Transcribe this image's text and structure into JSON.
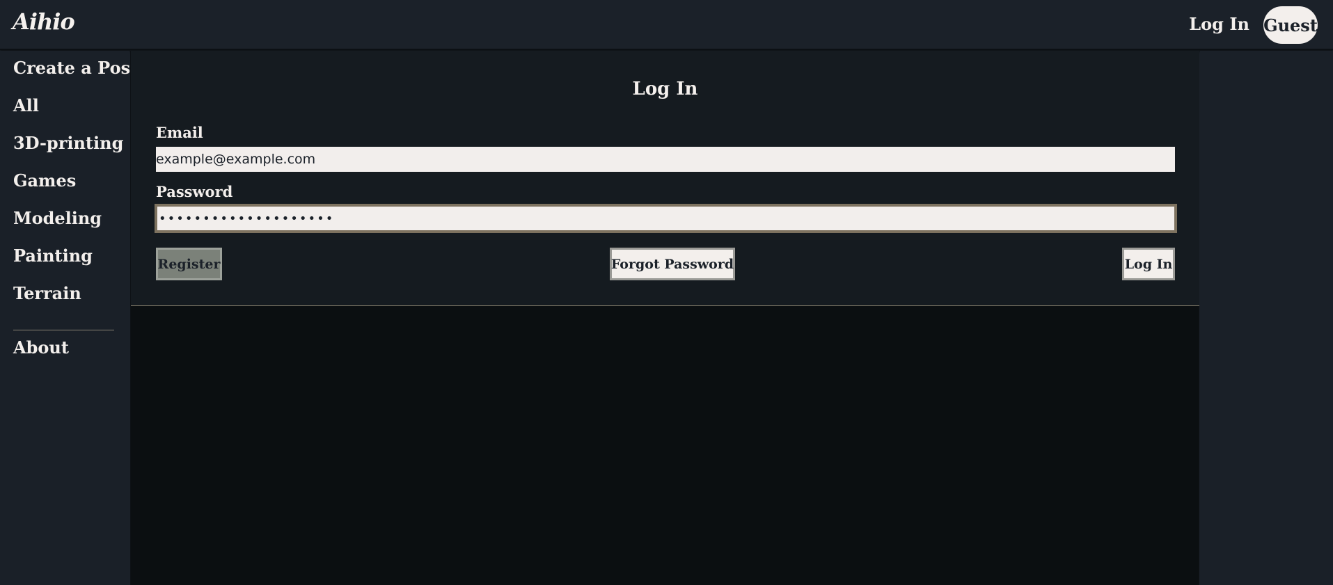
{
  "app": {
    "logo": "Aihio"
  },
  "header": {
    "login_label": "Log In",
    "user_label": "Guest"
  },
  "sidebar": {
    "items": [
      {
        "label": "Create a Post"
      },
      {
        "label": "All"
      },
      {
        "label": "3D-printing"
      },
      {
        "label": "Games"
      },
      {
        "label": "Modeling"
      },
      {
        "label": "Painting"
      },
      {
        "label": "Terrain"
      }
    ],
    "about_label": "About"
  },
  "login_form": {
    "title": "Log In",
    "email_label": "Email",
    "email_value": "example@example.com",
    "password_label": "Password",
    "password_value": "••••••••••••••••••••",
    "register_label": "Register",
    "forgot_label": "Forgot Password",
    "login_label": "Log In"
  },
  "colors": {
    "background": "#1a2028",
    "panel": "#151b20",
    "content_bg": "#0b0f11",
    "text_light": "#f3efec",
    "focus_border": "#7d725f",
    "register_button": "#7b8179"
  }
}
